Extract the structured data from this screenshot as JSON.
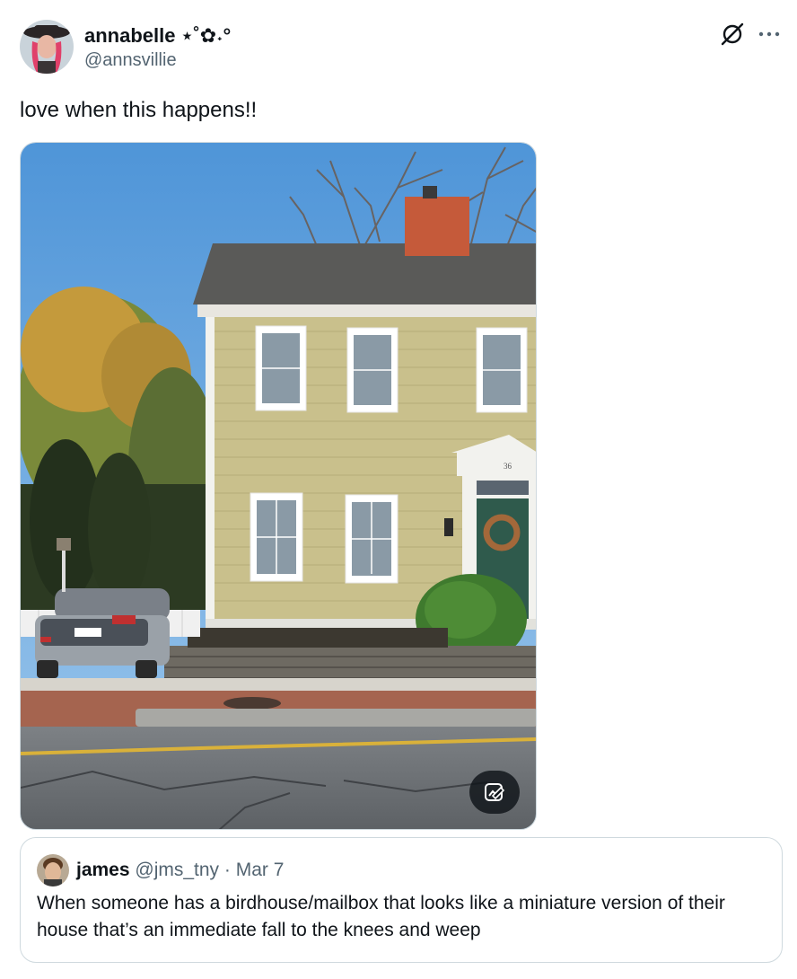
{
  "post": {
    "author": {
      "display_name": "annabelle ⋆˚✿˖°",
      "handle": "@annsvillie",
      "avatar": "avatar-photo"
    },
    "text": "love when this happens!!",
    "media": {
      "type": "photo",
      "house_number": "36",
      "alt_button_icon": "image-alt-icon"
    },
    "actions": {
      "grok_icon": "grok-icon",
      "more_icon": "more-icon"
    }
  },
  "quote": {
    "display_name": "james",
    "handle": "@jms_tny",
    "separator": "·",
    "date": "Mar 7",
    "text": "When someone has a birdhouse/mailbox that looks like a miniature version of their house that’s an immediate fall to the knees and weep"
  },
  "colors": {
    "text_primary": "#0f1419",
    "text_secondary": "#536471",
    "border": "#cfd9de"
  }
}
